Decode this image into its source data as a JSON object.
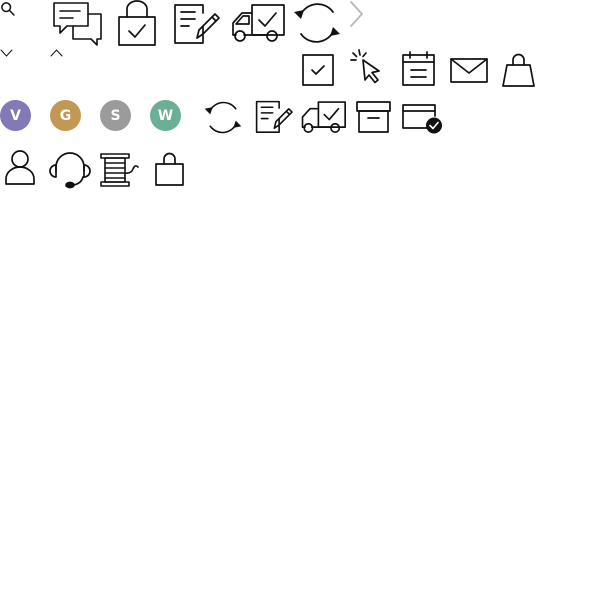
{
  "top_row": {
    "icons": [
      "search-icon",
      "chat-bubbles-icon",
      "lock-check-icon",
      "document-edit-icon",
      "delivery-truck-check-icon",
      "refresh-icon",
      "chevron-right-icon"
    ]
  },
  "arrows": {
    "icons": [
      "chevron-down-icon",
      "chevron-up-icon"
    ]
  },
  "second_row": {
    "icons": [
      "checkbox-checked-icon",
      "cursor-click-icon",
      "calendar-icon",
      "mail-icon",
      "shopping-bag-icon"
    ]
  },
  "badges": [
    {
      "letter": "V",
      "color": "#8279b6"
    },
    {
      "letter": "G",
      "color": "#c19954"
    },
    {
      "letter": "S",
      "color": "#9b9b9b"
    },
    {
      "letter": "W",
      "color": "#6aaf96"
    }
  ],
  "third_row": {
    "icons": [
      "refresh-icon",
      "document-edit-icon",
      "delivery-truck-check-icon",
      "archive-box-icon",
      "payment-card-check-icon"
    ]
  },
  "fourth_row": {
    "icons": [
      "user-icon",
      "headset-support-icon",
      "thread-spool-icon",
      "shopping-bag-icon"
    ]
  },
  "colors": {
    "stroke": "#111111",
    "chevron_light": "#b7b7b7"
  }
}
